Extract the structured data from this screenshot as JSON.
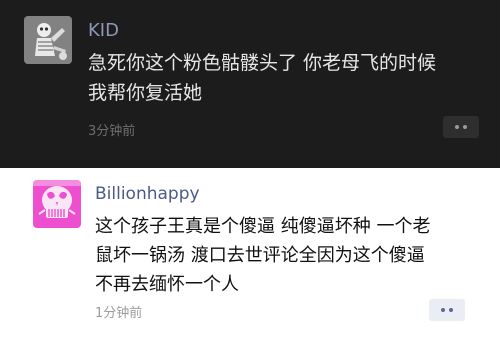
{
  "comments": [
    {
      "username": "KID",
      "content_lines": [
        "急死你这个粉色骷髅头了 你老母飞的时候",
        "我帮你复活她"
      ],
      "timestamp": "3分钟前",
      "avatar_icon": "skeleton-avatar",
      "more_icon": "more-dots-icon"
    },
    {
      "username": "Billionhappy",
      "content_lines": [
        "这个孩子王真是个傻逼 纯傻逼坏种 一个老",
        "鼠坏一锅汤 渡口去世评论全因为这个傻逼",
        "不再去缅怀一个人"
      ],
      "timestamp": "1分钟前",
      "avatar_icon": "pink-skull-avatar",
      "more_icon": "more-dots-icon"
    }
  ],
  "colors": {
    "dark_background": "#1c1c1c",
    "light_background": "#ffffff",
    "username_link": "#576b95",
    "pink_avatar": "#ee4fd0"
  }
}
